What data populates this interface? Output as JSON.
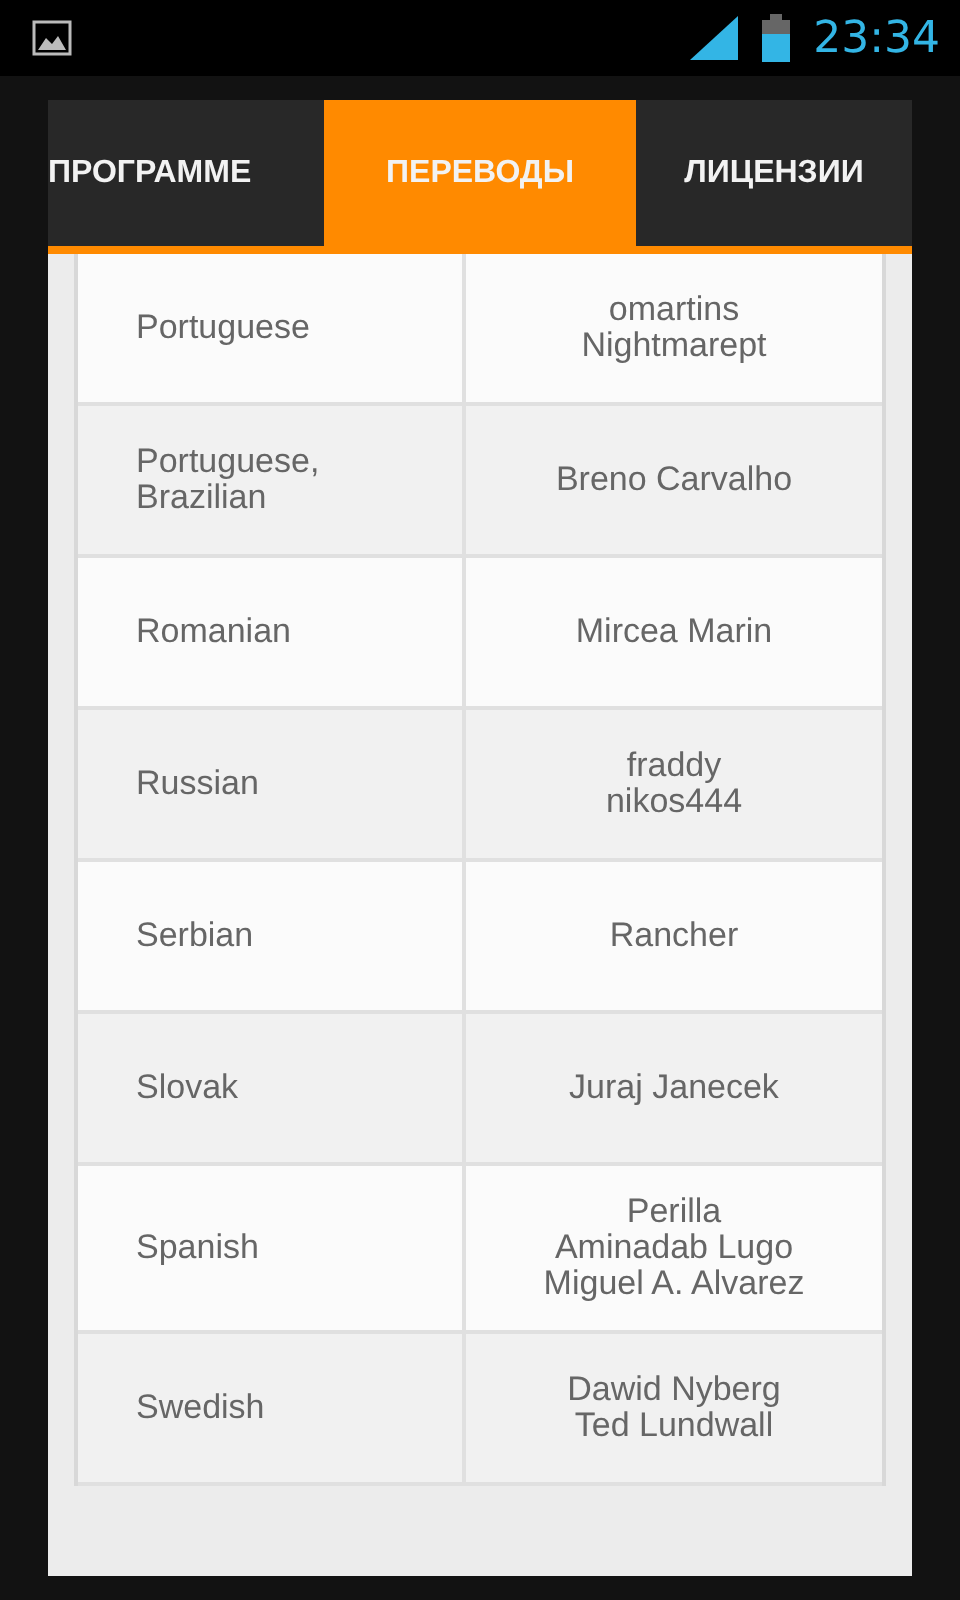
{
  "status_bar": {
    "time": "23:34"
  },
  "tabs": [
    {
      "label": "ПРОГРАММЕ",
      "selected": false
    },
    {
      "label": "ПЕРЕВОДЫ",
      "selected": true
    },
    {
      "label": "ЛИЦЕНЗИИ",
      "selected": false
    }
  ],
  "table": {
    "rows": [
      {
        "language": "Portuguese",
        "translators": [
          "omartins",
          "Nightmarept"
        ]
      },
      {
        "language": "Portuguese, Brazilian",
        "translators": [
          "Breno Carvalho"
        ]
      },
      {
        "language": "Romanian",
        "translators": [
          "Mircea Marin"
        ]
      },
      {
        "language": "Russian",
        "translators": [
          "fraddy",
          "nikos444"
        ]
      },
      {
        "language": "Serbian",
        "translators": [
          "Rancher"
        ]
      },
      {
        "language": "Slovak",
        "translators": [
          "Juraj Janecek"
        ]
      },
      {
        "language": "Spanish",
        "translators": [
          "Perilla",
          "Aminadab Lugo",
          "Miguel A. Alvarez"
        ]
      },
      {
        "language": "Swedish",
        "translators": [
          "Dawid Nyberg",
          "Ted Lundwall"
        ]
      }
    ]
  }
}
